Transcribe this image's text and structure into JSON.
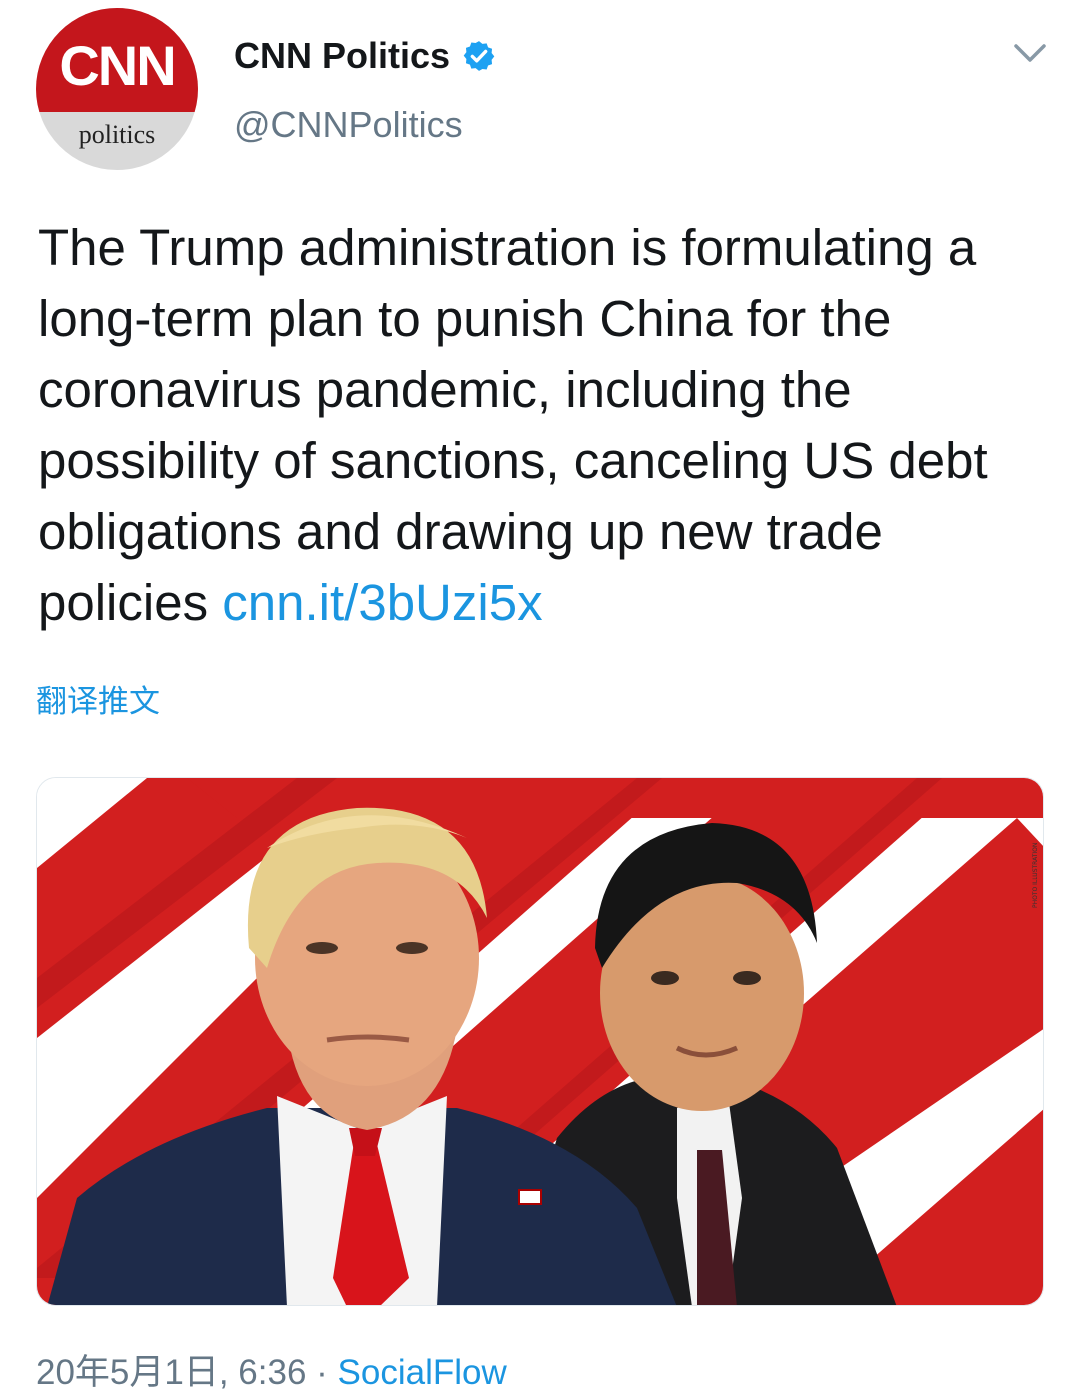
{
  "account": {
    "avatar_logo": "CNN",
    "avatar_sub": "politics",
    "display_name": "CNN Politics",
    "handle": "@CNNPolitics",
    "verified": true
  },
  "tweet": {
    "text": "The Trump administration is formulating a long-term plan to punish China for the coronavirus pandemic, including the possibility of sanctions, canceling US debt obligations and drawing up new trade policies ",
    "link": "cnn.it/3bUzi5x",
    "translate_label": "翻译推文"
  },
  "footer": {
    "timestamp": "20年5月1日, 6:36",
    "separator": " · ",
    "source": "SocialFlow"
  },
  "icons": {
    "verified": "verified-badge-icon",
    "menu": "chevron-down-icon"
  },
  "colors": {
    "link": "#1b95e0",
    "verified": "#1da1f2",
    "cnn_red": "#c4161c",
    "secondary_text": "#657786"
  }
}
